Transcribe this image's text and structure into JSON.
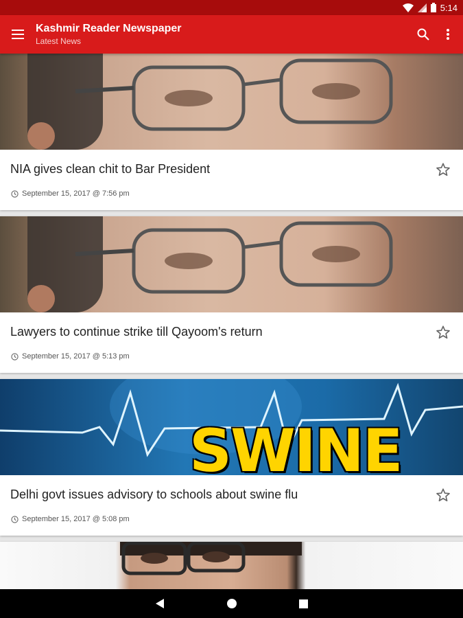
{
  "status_bar": {
    "time": "5:14",
    "icons": [
      "wifi-icon",
      "signal-icon",
      "battery-icon"
    ]
  },
  "app_bar": {
    "title": "Kashmir Reader Newspaper",
    "subtitle": "Latest News",
    "icons": [
      "menu-icon",
      "search-icon",
      "more-vert-icon"
    ],
    "color": "#d81b1b"
  },
  "articles": [
    {
      "headline": "NIA gives clean chit to Bar President",
      "date": "September 15, 2017 @ 7:56 pm",
      "image": "man-glasses-closeup"
    },
    {
      "headline": "Lawyers to continue strike till Qayoom's return",
      "date": "September 15, 2017 @ 5:13 pm",
      "image": "man-glasses-closeup"
    },
    {
      "headline": "Delhi govt issues advisory to schools about swine flu",
      "date": "September 15, 2017 @ 5:08 pm",
      "image": "swine-flu-graphic",
      "image_text": "SWINE"
    },
    {
      "image": "man-glasses-portrait"
    }
  ],
  "nav_bar": {
    "icons": [
      "back-icon",
      "home-icon",
      "recents-icon"
    ]
  }
}
